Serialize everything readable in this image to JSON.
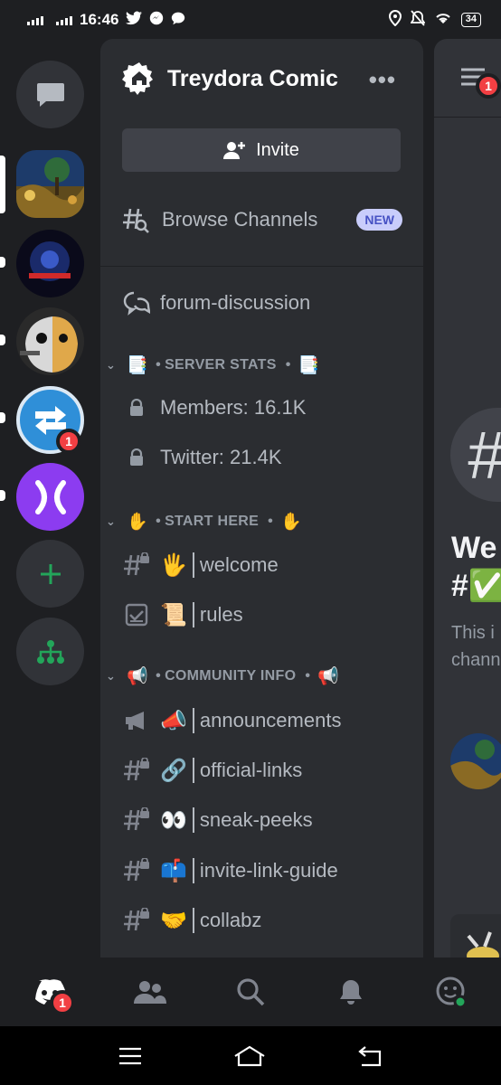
{
  "status_bar": {
    "time": "16:46",
    "battery": "34"
  },
  "rail": {
    "servers": [
      {
        "name": "server-landscape",
        "badge": ""
      },
      {
        "name": "server-adventure",
        "badge": ""
      },
      {
        "name": "server-doge",
        "badge": ""
      },
      {
        "name": "server-arrows",
        "badge": "1"
      },
      {
        "name": "server-purple",
        "badge": ""
      }
    ]
  },
  "panel": {
    "server_name": "Treydora Comic",
    "invite_label": "Invite",
    "browse_label": "Browse Channels",
    "new_badge": "NEW",
    "forum": "forum-discussion",
    "categories": {
      "server_stats": {
        "label": "SERVER STATS",
        "emoji": "📑"
      },
      "start_here": {
        "label": "START HERE",
        "emoji": "✋"
      },
      "community_info": {
        "label": "COMMUNITY INFO",
        "emoji": "📢"
      }
    },
    "channels": {
      "members": "Members: 16.1K",
      "twitter": "Twitter: 21.4K",
      "welcome": {
        "emoji": "🖐",
        "name": "welcome"
      },
      "rules": {
        "emoji": "📜",
        "name": "rules"
      },
      "announcements": {
        "emoji": "📣",
        "name": "announcements"
      },
      "official_links": {
        "emoji": "🔗",
        "name": "official-links"
      },
      "sneak_peeks": {
        "emoji": "👀",
        "name": "sneak-peeks"
      },
      "invite_link_guide": {
        "emoji": "📫",
        "name": "invite-link-guide"
      },
      "collabz": {
        "emoji": "🤝",
        "name": "collabz"
      }
    }
  },
  "chat": {
    "topbar_badge": "1",
    "welcome_line1": "We",
    "welcome_line2": "#✅",
    "desc_line1": "This i",
    "desc_line2": "chann"
  },
  "bottom_nav": {
    "home_badge": "1"
  },
  "colors": {
    "badge_red": "#f23f43",
    "green": "#23a55a",
    "blurple_light": "#c9cdfb",
    "purple_server": "#8c3cf0"
  }
}
